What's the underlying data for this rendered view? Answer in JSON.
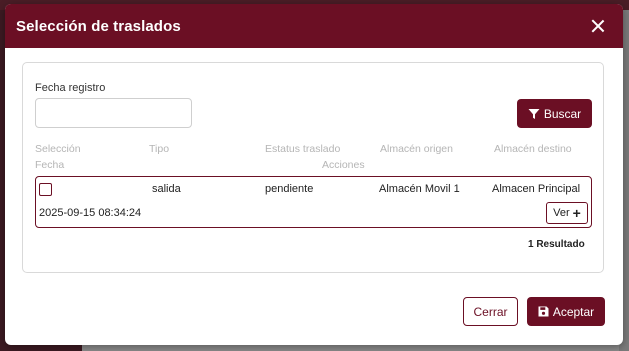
{
  "modal": {
    "title": "Selección de traslados"
  },
  "filters": {
    "date_label": "Fecha registro",
    "date_value": "",
    "date_placeholder": "",
    "search_label": "Buscar"
  },
  "table": {
    "headers": {
      "selection": "Selección",
      "type": "Tipo",
      "status": "Estatus traslado",
      "origin": "Almacén origen",
      "destination": "Almacén destino",
      "date": "Fecha",
      "actions": "Acciones"
    },
    "rows": [
      {
        "selected": false,
        "type": "salida",
        "status": "pendiente",
        "origin": "Almacén Movil 1",
        "destination": "Almacen Principal",
        "date": "2025-09-15 08:34:24",
        "action_label": "Ver"
      }
    ],
    "result_count": "1 Resultado"
  },
  "footer": {
    "cancel_label": "Cerrar",
    "accept_label": "Aceptar"
  },
  "colors": {
    "accent": "#6b0f24"
  }
}
